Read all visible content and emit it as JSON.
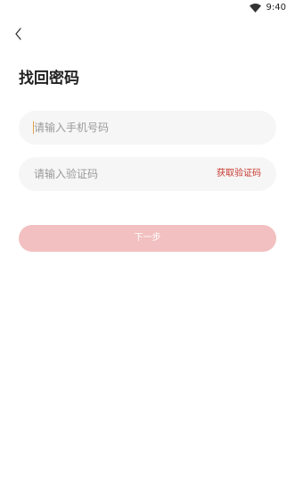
{
  "status_bar": {
    "time": "9:40",
    "icons": [
      "wifi-icon"
    ]
  },
  "header": {
    "back_icon": "chevron-left-icon",
    "title": "找回密码"
  },
  "form": {
    "phone_placeholder": "请输入手机号码",
    "phone_value": "",
    "code_placeholder": "请输入验证码",
    "code_value": "",
    "get_code_label": "获取验证码",
    "submit_label": "下一步"
  },
  "colors": {
    "accent": "#c8382e",
    "button_disabled_bg": "#f2c0c0",
    "field_bg": "#f6f6f6"
  }
}
